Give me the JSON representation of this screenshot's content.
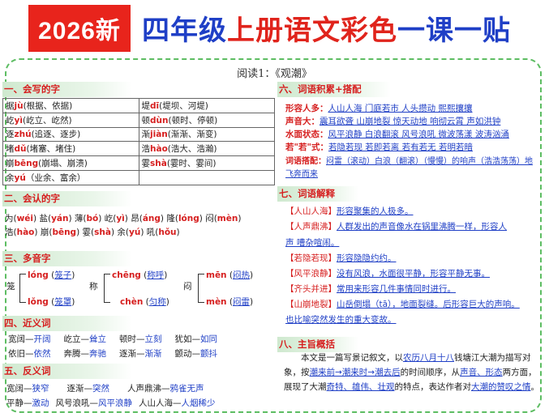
{
  "header": {
    "year_badge": "2026新",
    "title_part1": "四年级",
    "title_part2": "上册语文彩色",
    "title_part3": "一课一贴"
  },
  "reading_title": "阅读1：《观潮》",
  "sections": {
    "write": "一、会写的字",
    "recognize": "二、会认的字",
    "polyphone": "三、多音字",
    "synonym": "四、近义词",
    "antonym": "五、反义词",
    "accumulate": "六、词语积累+搭配",
    "explain": "七、词语解释",
    "theme": "八、主旨概括"
  },
  "write_table": [
    [
      "据 jù(根据、依据)",
      "堤 dī (堤坝、河堤)"
    ],
    [
      "屹 yì(屹立、屹然)",
      "顿 dùn(顿时、停顿)"
    ],
    [
      "逐 zhú(追逐、逐步)",
      "渐 jiàn(渐渐、渐变)"
    ],
    [
      "堵 dǔ(堵塞、堵住)",
      "浩 hào(浩大、浩瀚)"
    ],
    [
      "崩 bēng(崩塌、崩溃)",
      "霎 shà(霎时、霎间)"
    ],
    [
      "余 yú（业余、富余）",
      ""
    ]
  ],
  "write_table_parts": [
    [
      {
        "h": "据",
        "p": "jù",
        "w": "(根据、依据)"
      },
      {
        "h": "堤",
        "p": "dī",
        "w": "(堤坝、河堤)"
      }
    ],
    [
      {
        "h": "屹",
        "p": "yì",
        "w": "(屹立、屹然)"
      },
      {
        "h": "顿",
        "p": "dùn",
        "w": "(顿时、停顿)"
      }
    ],
    [
      {
        "h": "逐",
        "p": "zhú",
        "w": "(追逐、逐步)"
      },
      {
        "h": "渐",
        "p": "jiàn",
        "w": "(渐渐、渐变)"
      }
    ],
    [
      {
        "h": "堵",
        "p": "dǔ",
        "w": "(堵塞、堵住)"
      },
      {
        "h": "浩",
        "p": "hào",
        "w": "(浩大、浩瀚)"
      }
    ],
    [
      {
        "h": "崩",
        "p": "bēng",
        "w": "(崩塌、崩溃)"
      },
      {
        "h": "霎",
        "p": "shà",
        "w": "(霎时、霎间)"
      }
    ],
    [
      {
        "h": "余",
        "p": "yú",
        "w": "（业余、富余）"
      },
      {
        "h": "",
        "p": "",
        "w": ""
      }
    ]
  ],
  "recognize": {
    "line1": [
      {
        "c": "为",
        "p": "wéi"
      },
      {
        "c": "盐",
        "p": "yán"
      },
      {
        "c": "薄",
        "p": "bó"
      },
      {
        "c": "屹",
        "p": "yì"
      },
      {
        "c": "昂",
        "p": "áng"
      },
      {
        "c": "隆",
        "p": "lóng"
      },
      {
        "c": "闷",
        "p": "mèn"
      }
    ],
    "line2": [
      {
        "c": "浩",
        "p": "hào"
      },
      {
        "c": "崩",
        "p": "bēng"
      },
      {
        "c": "霎",
        "p": "shà"
      },
      {
        "c": "余",
        "p": "yú"
      },
      {
        "c": "吼",
        "p": "hǒu"
      }
    ]
  },
  "polyphone": {
    "g1": {
      "char": "笼",
      "r1": "lóng",
      "w1": "笼子",
      "r2": "lǒng",
      "w2": "笼罩"
    },
    "g2": {
      "char": "称",
      "r1": "chēng",
      "w1": "称呼",
      "r2": "chèn",
      "w2": "匀称"
    },
    "g3": {
      "char": "闷",
      "r1": "mēn",
      "w1": "闷热",
      "r2": "mèn",
      "w2": "闷雷"
    }
  },
  "synonyms": [
    [
      "宽阔—",
      "开阔",
      "屹立—",
      "耸立",
      "顿时—",
      "立刻",
      "犹如—",
      "如同"
    ],
    [
      "依旧—",
      "依然",
      "奔腾—",
      "奔驰",
      "逐渐—",
      "渐渐",
      "颤动—",
      "颤抖"
    ]
  ],
  "antonyms": [
    [
      "宽阔—",
      "狭窄",
      "逐渐—",
      "突然",
      "人声鼎沸—",
      "鸦雀无声"
    ],
    [
      "平静—",
      "激动",
      "风号浪吼—",
      "风平浪静",
      "人山人海—",
      "人烟稀少"
    ]
  ],
  "accumulate": [
    {
      "k": "形容人多：",
      "v": "人山人海  门庭若市  人头攒动    熙熙攘攘"
    },
    {
      "k": "声音大：",
      "v": "震耳欲聋  山崩地裂  惊天动地  响彻云霄  声如洪钟"
    },
    {
      "k": "水面状态：",
      "v": "风平浪静  白浪翻滚  风号浪吼  微波荡漾  波涛汹涌"
    },
    {
      "k": "若\"若\"式：",
      "v": "若隐若现  若即若离  若有若无  若明若暗"
    },
    {
      "k": "词语搭配：",
      "v": "闷雷（滚动）白浪（翻滚）（慢慢）的响声（浩浩荡荡）地"
    },
    {
      "k": "",
      "v": "飞奔而来"
    }
  ],
  "explain": [
    {
      "k": "【人山人海】",
      "v": "形容聚集的人极多。"
    },
    {
      "k": "【人声鼎沸】",
      "v": "人群发出的声音像水在锅里沸腾一样，形容人"
    },
    {
      "k": "",
      "v": "声  嘈杂喧闹。"
    },
    {
      "k": "【若隐若现】",
      "v": "形容隐隐约约。"
    },
    {
      "k": "【风平浪静】",
      "v": "没有风浪，水面很平静，形容平静无事。"
    },
    {
      "k": "【齐头并进】",
      "v": "常用来形容几件事情同时进行。"
    },
    {
      "k": "【山崩地裂】",
      "v": "山岳倒塌（tā），地面裂缝。后形容巨大的声响。"
    },
    {
      "k": "",
      "v": "也比喻突然发生的重大变故。"
    }
  ],
  "summary": {
    "t1": "本文是一篇写景记叙文，以",
    "u1": "农历八月十八",
    "t2": "钱塘江大潮为描写对象，按",
    "u2": "潮来前→潮来时→潮去后",
    "t3": "的时间顺序，从",
    "u3": "声音、形态",
    "t4": "两方面，展现了大潮",
    "u4": "奇特、雄伟、壮观",
    "t5": "的特点，表达作者对",
    "u5": "大潮的赞叹之情",
    "t6": "。"
  }
}
